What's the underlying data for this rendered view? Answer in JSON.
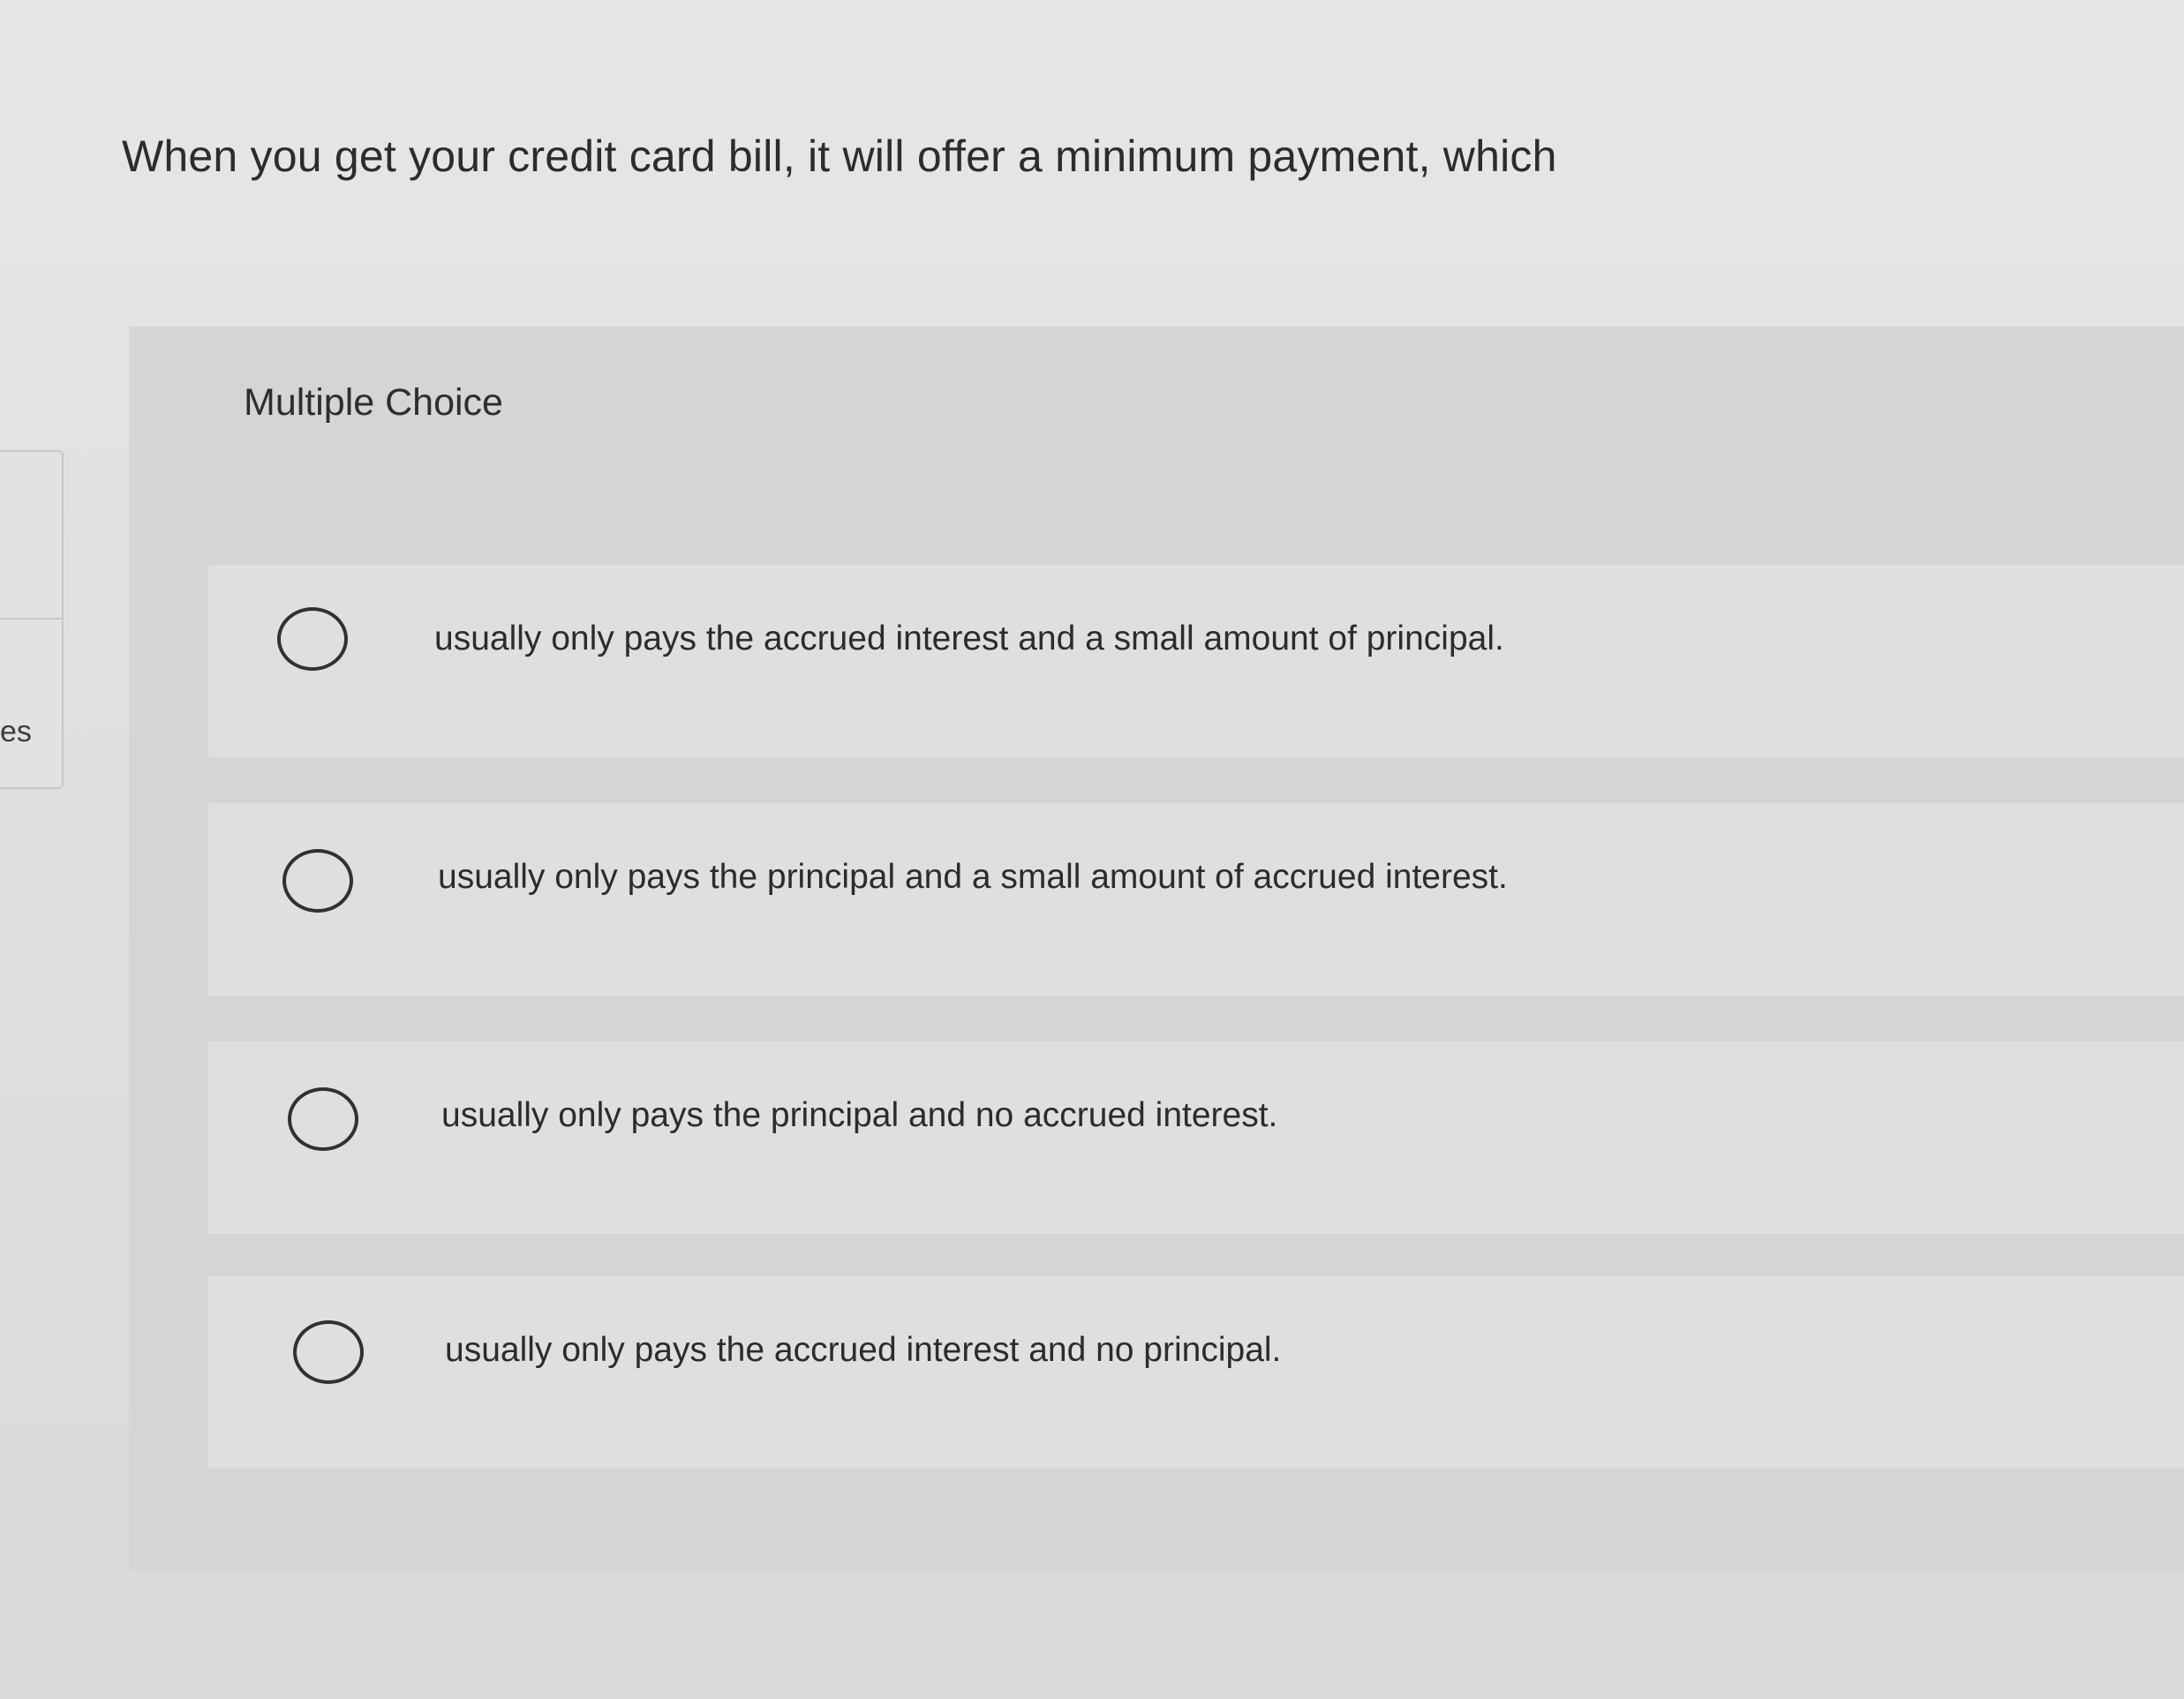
{
  "sidebar": {
    "fragment_text": "es"
  },
  "question": {
    "text": "When you get your credit card bill, it will offer a minimum payment, which"
  },
  "choices_panel": {
    "label": "Multiple Choice",
    "options": [
      {
        "label": "usually only pays the accrued interest and a small amount of principal.",
        "selected": false
      },
      {
        "label": "usually only pays the principal and a small amount of accrued interest.",
        "selected": false
      },
      {
        "label": "usually only pays the principal and no accrued interest.",
        "selected": false
      },
      {
        "label": "usually only pays the accrued interest and no principal.",
        "selected": false
      }
    ]
  }
}
